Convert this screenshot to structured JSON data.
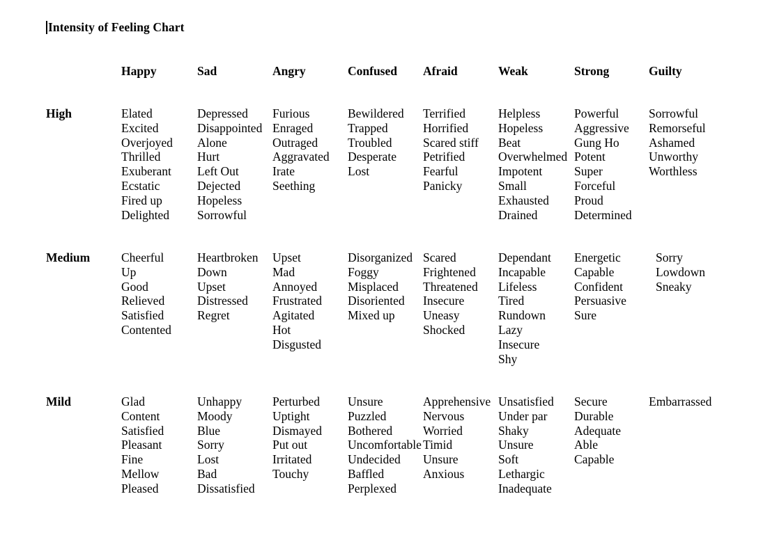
{
  "document": {
    "title": "Intensity of Feeling Chart",
    "text_cursor_visible": true,
    "background_color": "#ffffff",
    "text_color": "#000000"
  },
  "table": {
    "column_headers": [
      "Happy",
      "Sad",
      "Angry",
      "Confused",
      "Afraid",
      "Weak",
      "Strong",
      "Guilty"
    ],
    "row_headers": [
      "High",
      "Medium",
      "Mild"
    ],
    "rows": [
      {
        "intensity": "High",
        "cells": [
          [
            "Elated",
            "Excited",
            "Overjoyed",
            "Thrilled",
            "Exuberant",
            "Ecstatic",
            "Fired up",
            "Delighted"
          ],
          [
            "Depressed",
            "Disappointed",
            "Alone",
            "Hurt",
            "Left Out",
            "Dejected",
            "Hopeless",
            "Sorrowful"
          ],
          [
            "Furious",
            "Enraged",
            "Outraged",
            "Aggravated",
            "Irate",
            "Seething"
          ],
          [
            "Bewildered",
            "Trapped",
            "Troubled",
            "Desperate",
            "Lost"
          ],
          [
            "Terrified",
            "Horrified",
            "Scared stiff",
            "Petrified",
            "Fearful",
            "Panicky"
          ],
          [
            "Helpless",
            "Hopeless",
            "Beat",
            "Overwhelmed",
            "Impotent",
            "Small",
            "Exhausted",
            "Drained"
          ],
          [
            "Powerful",
            "Aggressive",
            "Gung Ho",
            "Potent",
            "Super",
            "Forceful",
            "Proud",
            "Determined"
          ],
          [
            "Sorrowful",
            "Remorseful",
            "Ashamed",
            "Unworthy",
            "Worthless"
          ]
        ]
      },
      {
        "intensity": "Medium",
        "cells": [
          [
            "Cheerful",
            "Up",
            "Good",
            "Relieved",
            "Satisfied",
            "Contented"
          ],
          [
            "Heartbroken",
            "Down",
            "Upset",
            "Distressed",
            "Regret"
          ],
          [
            "Upset",
            "Mad",
            "Annoyed",
            "Frustrated",
            "Agitated",
            "Hot",
            "Disgusted"
          ],
          [
            "Disorganized",
            "Foggy",
            "Misplaced",
            "Disoriented",
            "Mixed up"
          ],
          [
            "Scared",
            "Frightened",
            "Threatened",
            "Insecure",
            "Uneasy",
            "Shocked"
          ],
          [
            "Dependant",
            "Incapable",
            "Lifeless",
            "Tired",
            "Rundown",
            "Lazy",
            "Insecure",
            "Shy"
          ],
          [
            "Energetic",
            "Capable",
            "Confident",
            "Persuasive",
            "Sure"
          ],
          [
            "Sorry",
            "Lowdown",
            "Sneaky"
          ]
        ]
      },
      {
        "intensity": "Mild",
        "cells": [
          [
            "Glad",
            "Content",
            "Satisfied",
            "Pleasant",
            "Fine",
            "Mellow",
            "Pleased"
          ],
          [
            "Unhappy",
            "Moody",
            "Blue",
            "Sorry",
            "Lost",
            "Bad",
            "Dissatisfied"
          ],
          [
            "Perturbed",
            "Uptight",
            "Dismayed",
            "Put out",
            "Irritated",
            "Touchy"
          ],
          [
            "Unsure",
            "Puzzled",
            "Bothered",
            "Uncomfortable",
            "Undecided",
            "Baffled",
            "Perplexed"
          ],
          [
            "Apprehensive",
            "Nervous",
            "Worried",
            "Timid",
            "Unsure",
            "Anxious"
          ],
          [
            "Unsatisfied",
            "Under par",
            "Shaky",
            "Unsure",
            "Soft",
            "Lethargic",
            "Inadequate"
          ],
          [
            "Secure",
            "Durable",
            "Adequate",
            "Able",
            "Capable"
          ],
          [
            "Embarrassed"
          ]
        ]
      }
    ]
  }
}
